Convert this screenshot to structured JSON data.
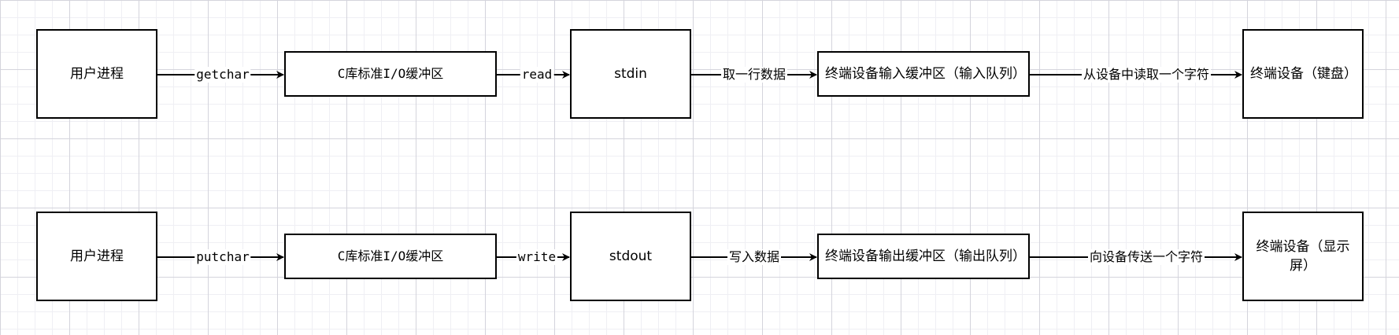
{
  "diagram": {
    "colors": {
      "stroke": "#000000",
      "fill": "#ffffff"
    },
    "rows": [
      {
        "nodes": [
          {
            "id": "process",
            "label": "用户进程"
          },
          {
            "id": "stdio",
            "label": "C库标准I/O缓冲区"
          },
          {
            "id": "stream",
            "label": "stdin"
          },
          {
            "id": "term-buffer",
            "label": "终端设备输入缓冲区（输入队列）"
          },
          {
            "id": "device",
            "label": "终端设备（键盘）"
          }
        ],
        "edges": [
          {
            "from": "process",
            "to": "stdio",
            "label": "getchar"
          },
          {
            "from": "stdio",
            "to": "stream",
            "label": "read"
          },
          {
            "from": "stream",
            "to": "term-buffer",
            "label": "取一行数据"
          },
          {
            "from": "term-buffer",
            "to": "device",
            "label": "从设备中读取一个字符"
          }
        ]
      },
      {
        "nodes": [
          {
            "id": "process",
            "label": "用户进程"
          },
          {
            "id": "stdio",
            "label": "C库标准I/O缓冲区"
          },
          {
            "id": "stream",
            "label": "stdout"
          },
          {
            "id": "term-buffer",
            "label": "终端设备输出缓冲区（输出队列）"
          },
          {
            "id": "device",
            "label": "终端设备（显示屏）"
          }
        ],
        "edges": [
          {
            "from": "process",
            "to": "stdio",
            "label": "putchar"
          },
          {
            "from": "stdio",
            "to": "stream",
            "label": "write"
          },
          {
            "from": "stream",
            "to": "term-buffer",
            "label": "写入数据"
          },
          {
            "from": "term-buffer",
            "to": "device",
            "label": "向设备传送一个字符"
          }
        ]
      }
    ]
  }
}
